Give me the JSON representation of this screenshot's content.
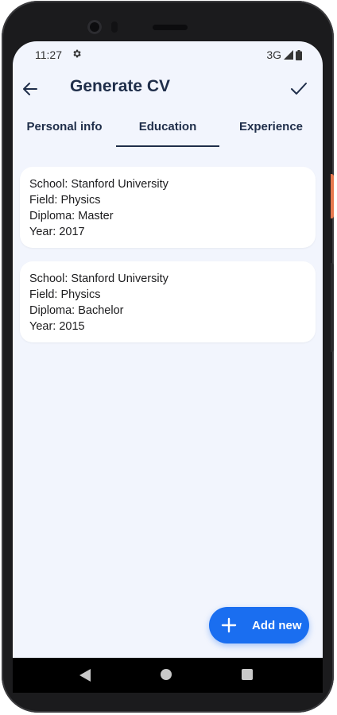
{
  "status": {
    "time": "11:27",
    "network": "3G",
    "icons": [
      "settings-gear-icon",
      "signal-icon",
      "battery-icon"
    ]
  },
  "appbar": {
    "title": "Generate CV",
    "back_icon": "arrow-back-icon",
    "confirm_icon": "check-icon"
  },
  "tabs": [
    {
      "label": "Personal info",
      "selected": false
    },
    {
      "label": "Education",
      "selected": true
    },
    {
      "label": "Experience",
      "selected": false
    }
  ],
  "education": [
    {
      "school": "School: Stanford University",
      "field": "Field: Physics",
      "diploma": "Diploma: Master",
      "year": "Year: 2017"
    },
    {
      "school": "School: Stanford University",
      "field": "Field: Physics",
      "diploma": "Diploma: Bachelor",
      "year": "Year: 2015"
    }
  ],
  "fab": {
    "label": "Add new",
    "icon": "plus-icon"
  },
  "colors": {
    "accent": "#1a6ef0",
    "title": "#1f2e4a",
    "background": "#f2f5fd"
  }
}
